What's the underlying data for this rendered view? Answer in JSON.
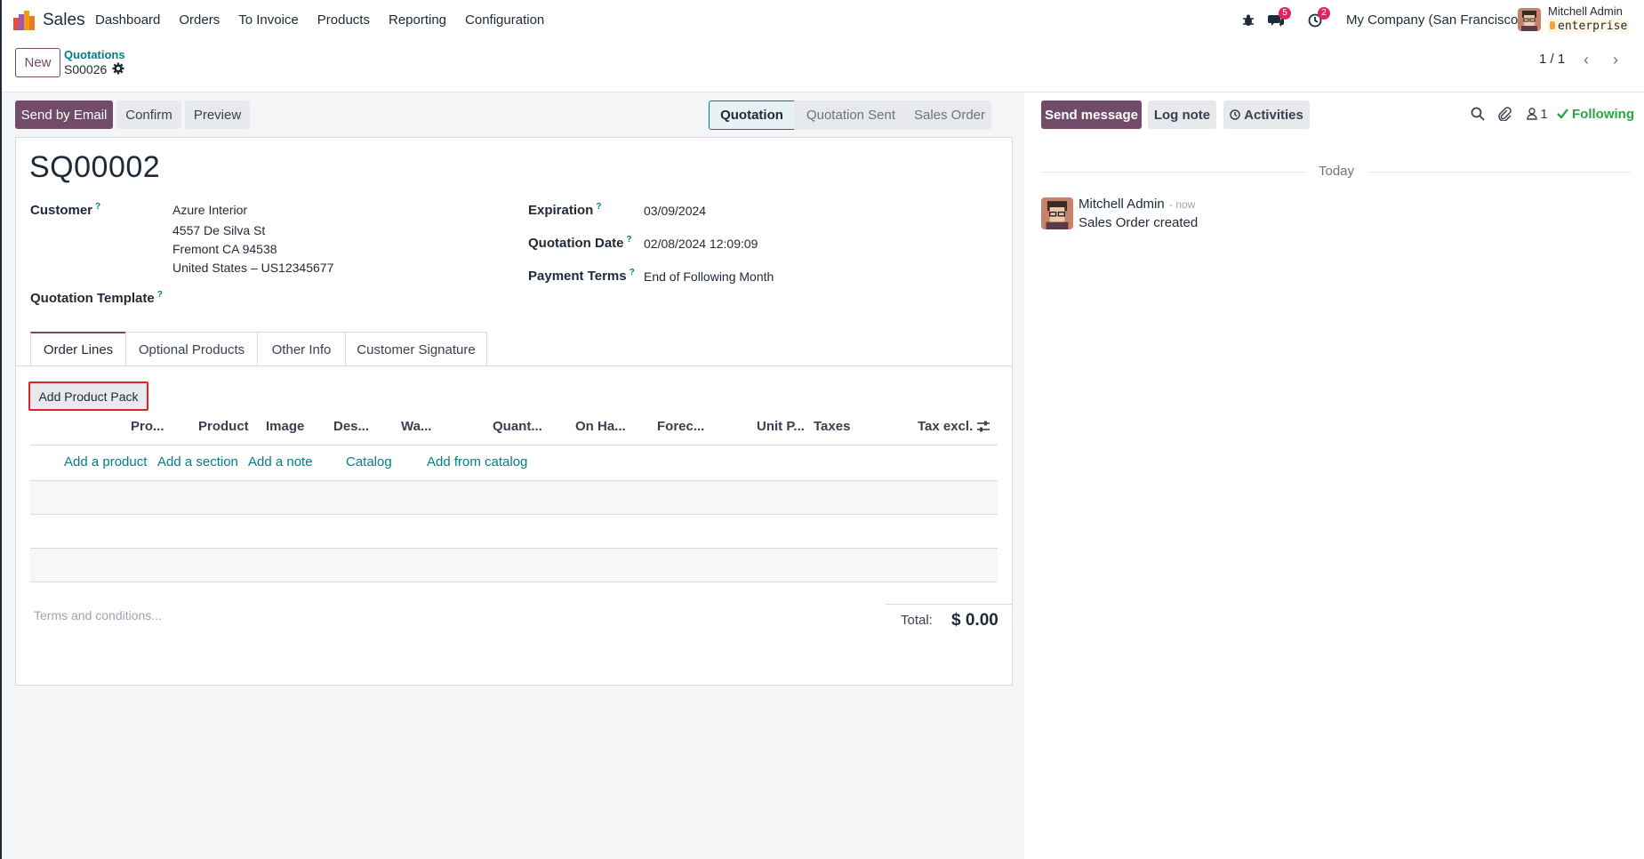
{
  "app": {
    "name": "Sales",
    "menu": [
      "Dashboard",
      "Orders",
      "To Invoice",
      "Products",
      "Reporting",
      "Configuration"
    ]
  },
  "systray": {
    "messages_count": "5",
    "activities_count": "2",
    "company": "My Company (San Francisco)",
    "user_name": "Mitchell Admin",
    "database": "enterprise"
  },
  "control_panel": {
    "new_label": "New",
    "breadcrumb_parent": "Quotations",
    "breadcrumb_current": "S00026",
    "pager": "1 / 1"
  },
  "actions": {
    "send_by_email": "Send by Email",
    "confirm": "Confirm",
    "preview": "Preview"
  },
  "statusbar": {
    "stages": [
      "Quotation",
      "Quotation Sent",
      "Sales Order"
    ],
    "active": "Quotation"
  },
  "form": {
    "title": "SQ00002",
    "customer_label": "Customer",
    "customer_name": "Azure Interior",
    "customer_address_1": "4557 De Silva St",
    "customer_address_2": "Fremont CA 94538",
    "customer_address_3": "United States – US12345677",
    "template_label": "Quotation Template",
    "expiration_label": "Expiration",
    "expiration_value": "03/09/2024",
    "quotation_date_label": "Quotation Date",
    "quotation_date_value": "02/08/2024 12:09:09",
    "payment_terms_label": "Payment Terms",
    "payment_terms_value": "End of Following Month",
    "help_mark": "?"
  },
  "tabs": [
    "Order Lines",
    "Optional Products",
    "Other Info",
    "Customer Signature"
  ],
  "order_lines": {
    "add_pack_label": "Add Product Pack",
    "columns": [
      "Pro...",
      "Product",
      "Image",
      "Des...",
      "Wa...",
      "Quant...",
      "On Ha...",
      "Forec...",
      "Unit P...",
      "Taxes",
      "Tax excl."
    ],
    "add_links": [
      "Add a product",
      "Add a section",
      "Add a note",
      "Catalog",
      "Add from catalog"
    ],
    "terms_placeholder": "Terms and conditions...",
    "total_label": "Total:",
    "total_value": "$ 0.00"
  },
  "chatter": {
    "send_message": "Send message",
    "log_note": "Log note",
    "activities": "Activities",
    "followers_count": "1",
    "following": "Following",
    "date_separator": "Today",
    "message": {
      "author": "Mitchell Admin",
      "time": "- now",
      "body": "Sales Order created"
    }
  },
  "colors": {
    "primary": "#714b67",
    "link": "#017e84",
    "success": "#28a745",
    "highlight_border": "#e0202d"
  }
}
